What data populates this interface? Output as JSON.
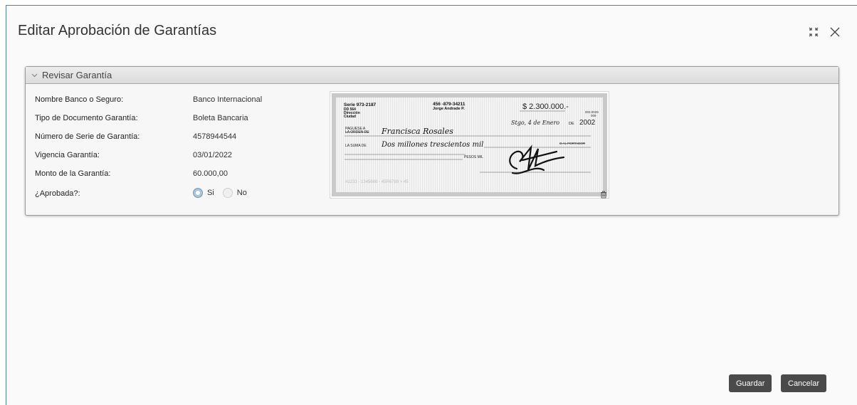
{
  "modal": {
    "title": "Editar Aprobación de Garantías",
    "icons": {
      "collapse": "compress-icon",
      "close": "close-icon"
    }
  },
  "panel": {
    "header_label": "Revisar Garantía",
    "fields": [
      {
        "label": "Nombre Banco o Seguro:",
        "value": "Banco Internacional"
      },
      {
        "label": "Tipo de Documento Garantía:",
        "value": "Boleta Bancaria"
      },
      {
        "label": "Número de Serie de Garantía:",
        "value": "4578944544"
      },
      {
        "label": "Vigencia Garantía:",
        "value": "03/01/2022"
      },
      {
        "label": "Monto de la Garantía:",
        "value": "60.000,00"
      }
    ],
    "approval": {
      "label": "¿Aprobada?:",
      "options": [
        "Si",
        "No"
      ],
      "selected": "Si"
    }
  },
  "cheque": {
    "serie": "Serie 973-2187",
    "dd": "DD 564",
    "direccion": "Dirección",
    "ciudad": "Ciudad",
    "account": "456 -879-34211",
    "holder": "Jorge Andrade P.",
    "amount": "$ 2.300.000.-",
    "date": "Stgo, 4 de Enero",
    "date_de": "DE",
    "year": "2002",
    "paguese_label": "PAGUESE A",
    "orden_label": "LA ORDEN DE",
    "payee": "Francisca Rosales",
    "suma_label": "LA SUMA DE",
    "amount_words": "Dos millones trescientos mil",
    "portador_label": "O AL PORTADOR",
    "pesos_label": "PESOS M/L",
    "micr": "#1233 - 1345666 - 45R6789 > 45",
    "bank_code": "003.0029",
    "branch_code": "009"
  },
  "buttons": {
    "save": "Guardar",
    "cancel": "Cancelar"
  },
  "colors": {
    "modal_border": "#4f7fb0",
    "button_bg": "#4a4a4a",
    "radio_selected": "#a9c5dc"
  }
}
